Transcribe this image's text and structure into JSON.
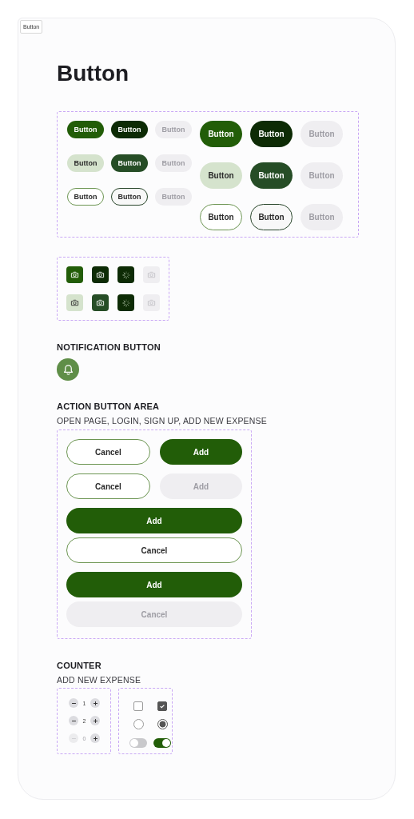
{
  "frame_tag": "Button",
  "title": "Button",
  "button_sets": [
    {
      "rows": [
        [
          {
            "label": "Button",
            "kind": "primary"
          },
          {
            "label": "Button",
            "kind": "dark"
          },
          {
            "label": "Button",
            "kind": "disabled"
          }
        ],
        [
          {
            "label": "Button",
            "kind": "tonal"
          },
          {
            "label": "Button",
            "kind": "dark-tonal"
          },
          {
            "label": "Button",
            "kind": "disabled"
          }
        ],
        [
          {
            "label": "Button",
            "kind": "outline"
          },
          {
            "label": "Button",
            "kind": "outline-dark"
          },
          {
            "label": "Button",
            "kind": "disabled"
          }
        ]
      ]
    },
    {
      "rows": [
        [
          {
            "label": "Button",
            "kind": "primary"
          },
          {
            "label": "Button",
            "kind": "dark"
          },
          {
            "label": "Button",
            "kind": "disabled"
          }
        ],
        [
          {
            "label": "Button",
            "kind": "tonal"
          },
          {
            "label": "Button",
            "kind": "dark-tonal"
          },
          {
            "label": "Button",
            "kind": "disabled"
          }
        ],
        [
          {
            "label": "Button",
            "kind": "outline"
          },
          {
            "label": "Button",
            "kind": "outline-dark"
          },
          {
            "label": "Button",
            "kind": "disabled"
          }
        ]
      ]
    }
  ],
  "icon_buttons": [
    [
      {
        "kind": "primary"
      },
      {
        "kind": "dark"
      },
      {
        "kind": "loading"
      },
      {
        "kind": "disabled"
      }
    ],
    [
      {
        "kind": "tonal"
      },
      {
        "kind": "dark-tonal"
      },
      {
        "kind": "loading"
      },
      {
        "kind": "disabled"
      }
    ]
  ],
  "notification": {
    "heading": "NOTIFICATION BUTTON"
  },
  "action_area": {
    "heading": "ACTION BUTTON AREA",
    "subtitle": "OPEN PAGE, LOGIN, SIGN UP, ADD NEW EXPENSE",
    "rows": [
      [
        {
          "label": "Cancel",
          "kind": "outline"
        },
        {
          "label": "Add",
          "kind": "primary"
        }
      ],
      [
        {
          "label": "Cancel",
          "kind": "outline"
        },
        {
          "label": "Add",
          "kind": "disabled"
        }
      ],
      [
        {
          "label": "Add",
          "kind": "primary"
        }
      ],
      [
        {
          "label": "Cancel",
          "kind": "outline"
        }
      ],
      [
        {
          "label": "Add",
          "kind": "primary"
        }
      ],
      [
        {
          "label": "Cancel",
          "kind": "disabled"
        }
      ]
    ]
  },
  "counter": {
    "heading": "COUNTER",
    "subtitle": "ADD NEW EXPENSE",
    "counters": [
      {
        "value": "1",
        "disabled": false
      },
      {
        "value": "2",
        "disabled": false
      },
      {
        "value": "0",
        "disabled": true
      }
    ],
    "controls": [
      {
        "kind": "checkbox",
        "checked": false
      },
      {
        "kind": "checkbox",
        "checked": true
      },
      {
        "kind": "radio",
        "checked": false
      },
      {
        "kind": "radio",
        "checked": true
      },
      {
        "kind": "toggle",
        "checked": false
      },
      {
        "kind": "toggle",
        "checked": true
      }
    ]
  }
}
